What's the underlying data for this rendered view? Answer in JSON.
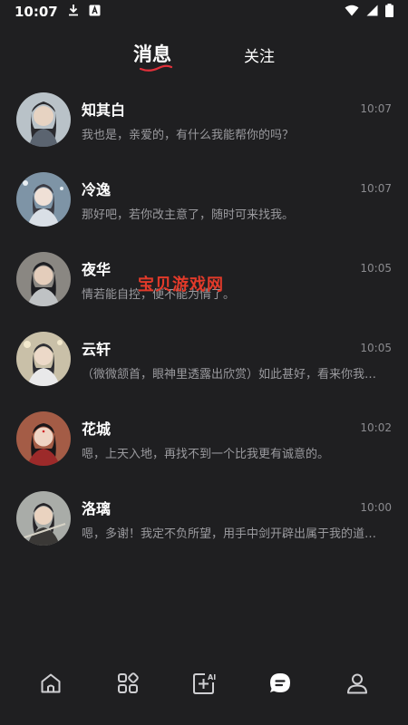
{
  "status_bar": {
    "time": "10:07"
  },
  "tabs": [
    {
      "label": "消息",
      "active": true
    },
    {
      "label": "关注",
      "active": false
    }
  ],
  "messages": [
    {
      "name": "知其白",
      "time": "10:07",
      "preview": "我也是，亲爱的，有什么我能帮你的吗？"
    },
    {
      "name": "冷逸",
      "time": "10:07",
      "preview": "那好吧，若你改主意了，随时可来找我。"
    },
    {
      "name": "夜华",
      "time": "10:05",
      "preview": "情若能自控，便不能为情了。"
    },
    {
      "name": "云轩",
      "time": "10:05",
      "preview": "（微微颔首，眼神里透露出欣赏）如此甚好，看来你我真是志同道合"
    },
    {
      "name": "花城",
      "time": "10:02",
      "preview": "嗯，上天入地，再找不到一个比我更有诚意的。"
    },
    {
      "name": "洛璃",
      "time": "10:00",
      "preview": "嗯，多谢！我定不负所望，用手中剑开辟出属于我的道路！"
    }
  ],
  "watermark": "宝贝游戏网",
  "bottom_nav": [
    {
      "icon": "home-icon",
      "active": false
    },
    {
      "icon": "apps-grid-icon",
      "active": false
    },
    {
      "icon": "ai-create-icon",
      "active": false
    },
    {
      "icon": "chat-bubble-icon",
      "active": true
    },
    {
      "icon": "profile-icon",
      "active": false
    }
  ],
  "colors": {
    "background": "#1f1f21",
    "text_primary": "#ffffff",
    "text_secondary": "#9a9a9e",
    "accent_underline": "#e0303a"
  }
}
